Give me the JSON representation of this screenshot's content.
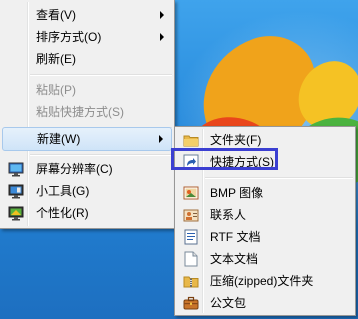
{
  "main_menu": {
    "items": [
      {
        "label": "查看(V)",
        "submenu": true,
        "disabled": false
      },
      {
        "label": "排序方式(O)",
        "submenu": true,
        "disabled": false
      },
      {
        "label": "刷新(E)",
        "submenu": false,
        "disabled": false
      },
      {
        "label": "粘贴(P)",
        "submenu": false,
        "disabled": true
      },
      {
        "label": "粘贴快捷方式(S)",
        "submenu": false,
        "disabled": true
      },
      {
        "label": "新建(W)",
        "submenu": true,
        "disabled": false,
        "active": true
      },
      {
        "label": "屏幕分辨率(C)",
        "icon": "display-icon"
      },
      {
        "label": "小工具(G)",
        "icon": "gadgets-icon"
      },
      {
        "label": "个性化(R)",
        "icon": "personalize-icon"
      }
    ]
  },
  "sub_menu": {
    "items": [
      {
        "label": "文件夹(F)",
        "icon": "folder-icon"
      },
      {
        "label": "快捷方式(S)",
        "icon": "shortcut-icon",
        "highlighted": true
      },
      {
        "label": "BMP 图像",
        "icon": "bmp-image-icon"
      },
      {
        "label": "联系人",
        "icon": "contact-icon"
      },
      {
        "label": "RTF 文档",
        "icon": "rtf-document-icon"
      },
      {
        "label": "文本文档",
        "icon": "text-document-icon"
      },
      {
        "label": "压缩(zipped)文件夹",
        "icon": "zip-folder-icon"
      },
      {
        "label": "公文包",
        "icon": "briefcase-icon"
      }
    ]
  },
  "colors": {
    "menu_background": "#f0f0f0",
    "highlight_border": "#3b3fd1",
    "disabled_text": "#8d8d8d"
  }
}
